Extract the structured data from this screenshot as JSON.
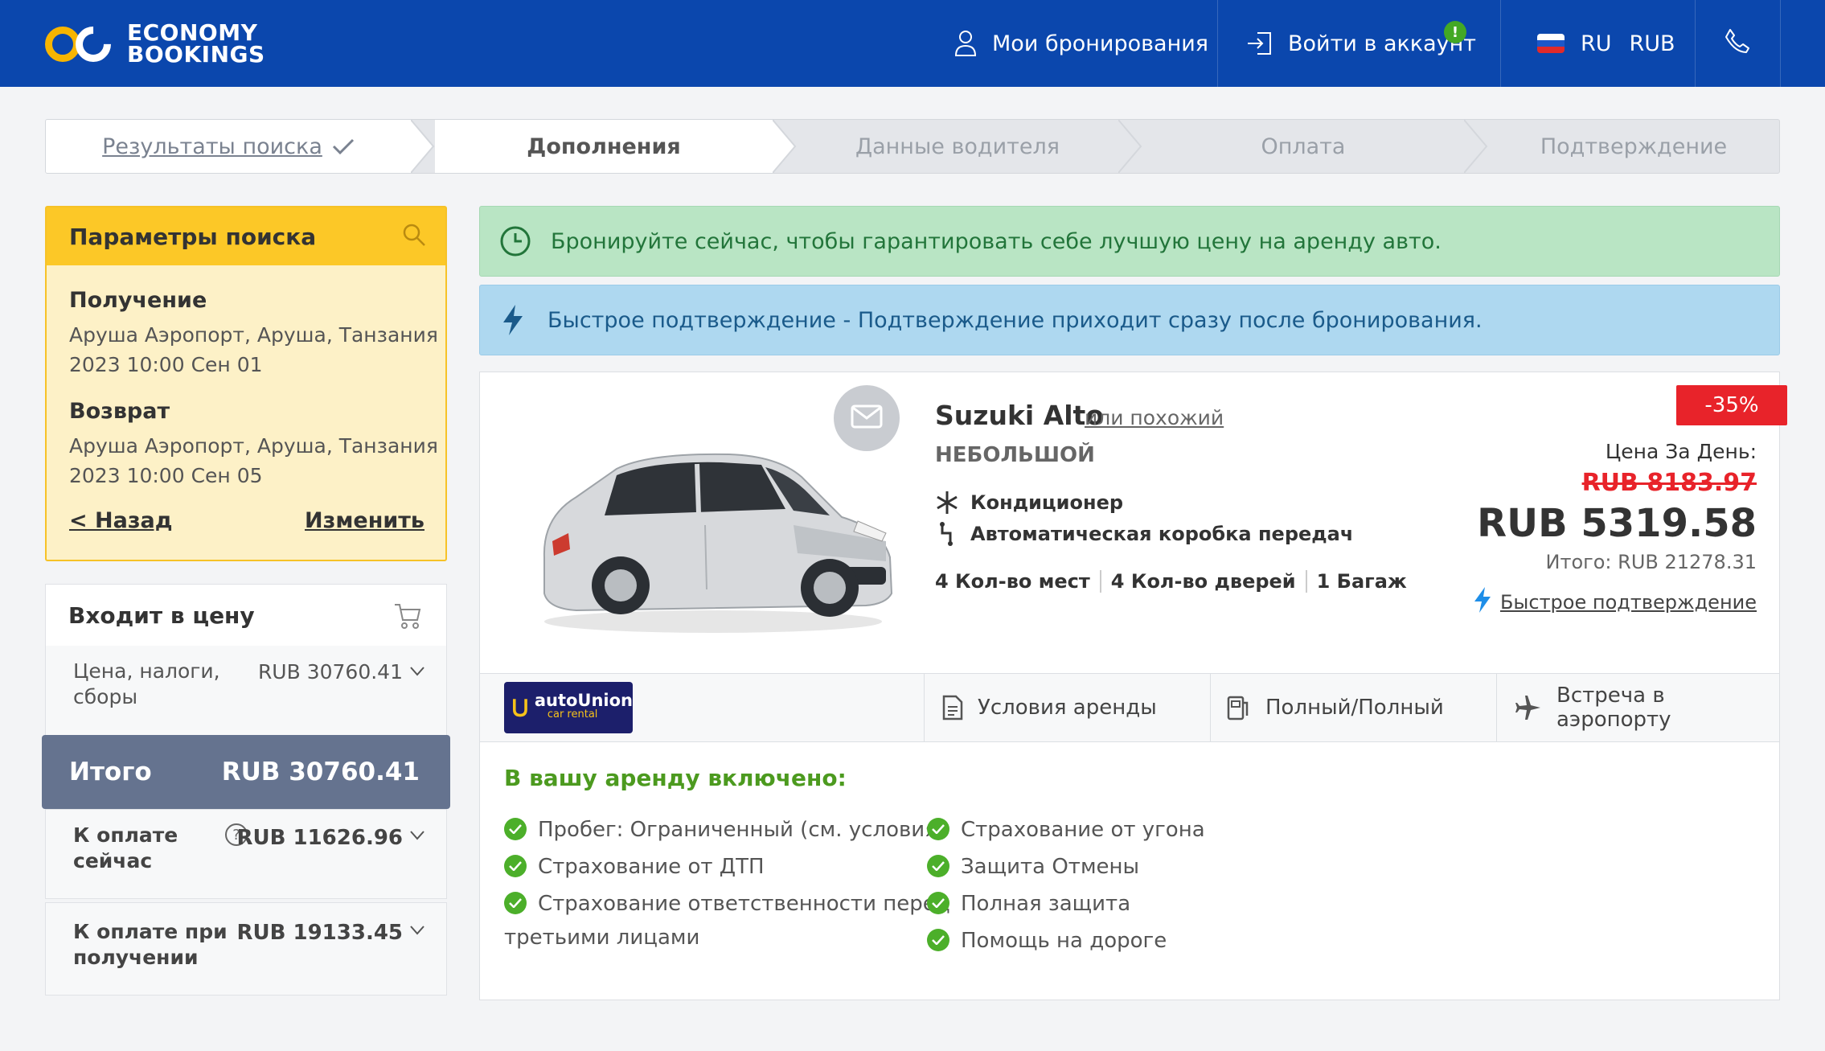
{
  "header": {
    "logo_line1": "ECONOMY",
    "logo_line2": "BOOKINGS",
    "my_bookings": "Мои бронирования",
    "login": "Войти в аккаунт",
    "login_badge": "!",
    "language": "RU",
    "currency": "RUB"
  },
  "steps": [
    {
      "label": "Результаты поиска",
      "state": "done"
    },
    {
      "label": "Дополнения",
      "state": "active"
    },
    {
      "label": "Данные водителя",
      "state": "pending"
    },
    {
      "label": "Оплата",
      "state": "pending"
    },
    {
      "label": "Подтверждение",
      "state": "pending"
    }
  ],
  "search": {
    "title": "Параметры поиска",
    "pickup_label": "Получение",
    "pickup_location": "Аруша Аэропорт, Аруша, Танзания",
    "pickup_datetime": "2023 10:00 Сен 01",
    "return_label": "Возврат",
    "return_location": "Аруша Аэропорт, Аруша, Танзания",
    "return_datetime": "2023 10:00 Сен 05",
    "back_link": "< Назад",
    "change_link": "Изменить"
  },
  "price_summary": {
    "title": "Входит в цену",
    "row_label_1": "Цена, налоги,",
    "row_label_2": "сборы",
    "row_value": "RUB 30760.41",
    "total_label": "Итого",
    "total_value": "RUB 30760.41",
    "pay_now_label_1": "К оплате",
    "pay_now_label_2": "сейчас",
    "pay_now_value": "RUB 11626.96",
    "pay_later_label_1": "К оплате при",
    "pay_later_label_2": "получении",
    "pay_later_value": "RUB 19133.45"
  },
  "alerts": {
    "green": "Бронируйте сейчас, чтобы гарантировать себе лучшую цену на аренду авто.",
    "blue": "Быстрое подтверждение - Подтверждение приходит сразу после бронирования."
  },
  "car": {
    "name": "Suzuki Alto",
    "or_similar": "или похожий",
    "category": "НЕБОЛЬШОЙ",
    "feature_ac": "Кондиционер",
    "feature_gearbox": "Автоматическая коробка передач",
    "seats": "4 Кол-во мест",
    "doors": "4 Кол-во дверей",
    "bags": "1 Багаж",
    "discount": "-35%",
    "price_label": "Цена За День:",
    "old_price": "RUB 8183.97",
    "new_price": "RUB 5319.58",
    "total": "Итого: RUB 21278.31",
    "quick_confirm": "Быстрое подтверждение",
    "supplier_name": "autoUnion",
    "supplier_sub": "car rental"
  },
  "tabs": {
    "terms": "Условия аренды",
    "fuel": "Полный/Полный",
    "meet": "Встреча в аэропорту"
  },
  "included": {
    "title": "В вашу аренду включено:",
    "left": [
      "Пробег: Ограниченный (см. условия)",
      "Страхование от ДТП",
      "Страхование ответственности перед",
      "третьими лицами"
    ],
    "right": [
      "Страхование от угона",
      "Защита Отмены",
      "Полная защита",
      "Помощь на дороге"
    ]
  },
  "colors": {
    "header_bg": "#0b47ad",
    "accent_yellow": "#fcc827",
    "discount_red": "#e8232a",
    "check_green": "#4caf2a"
  }
}
